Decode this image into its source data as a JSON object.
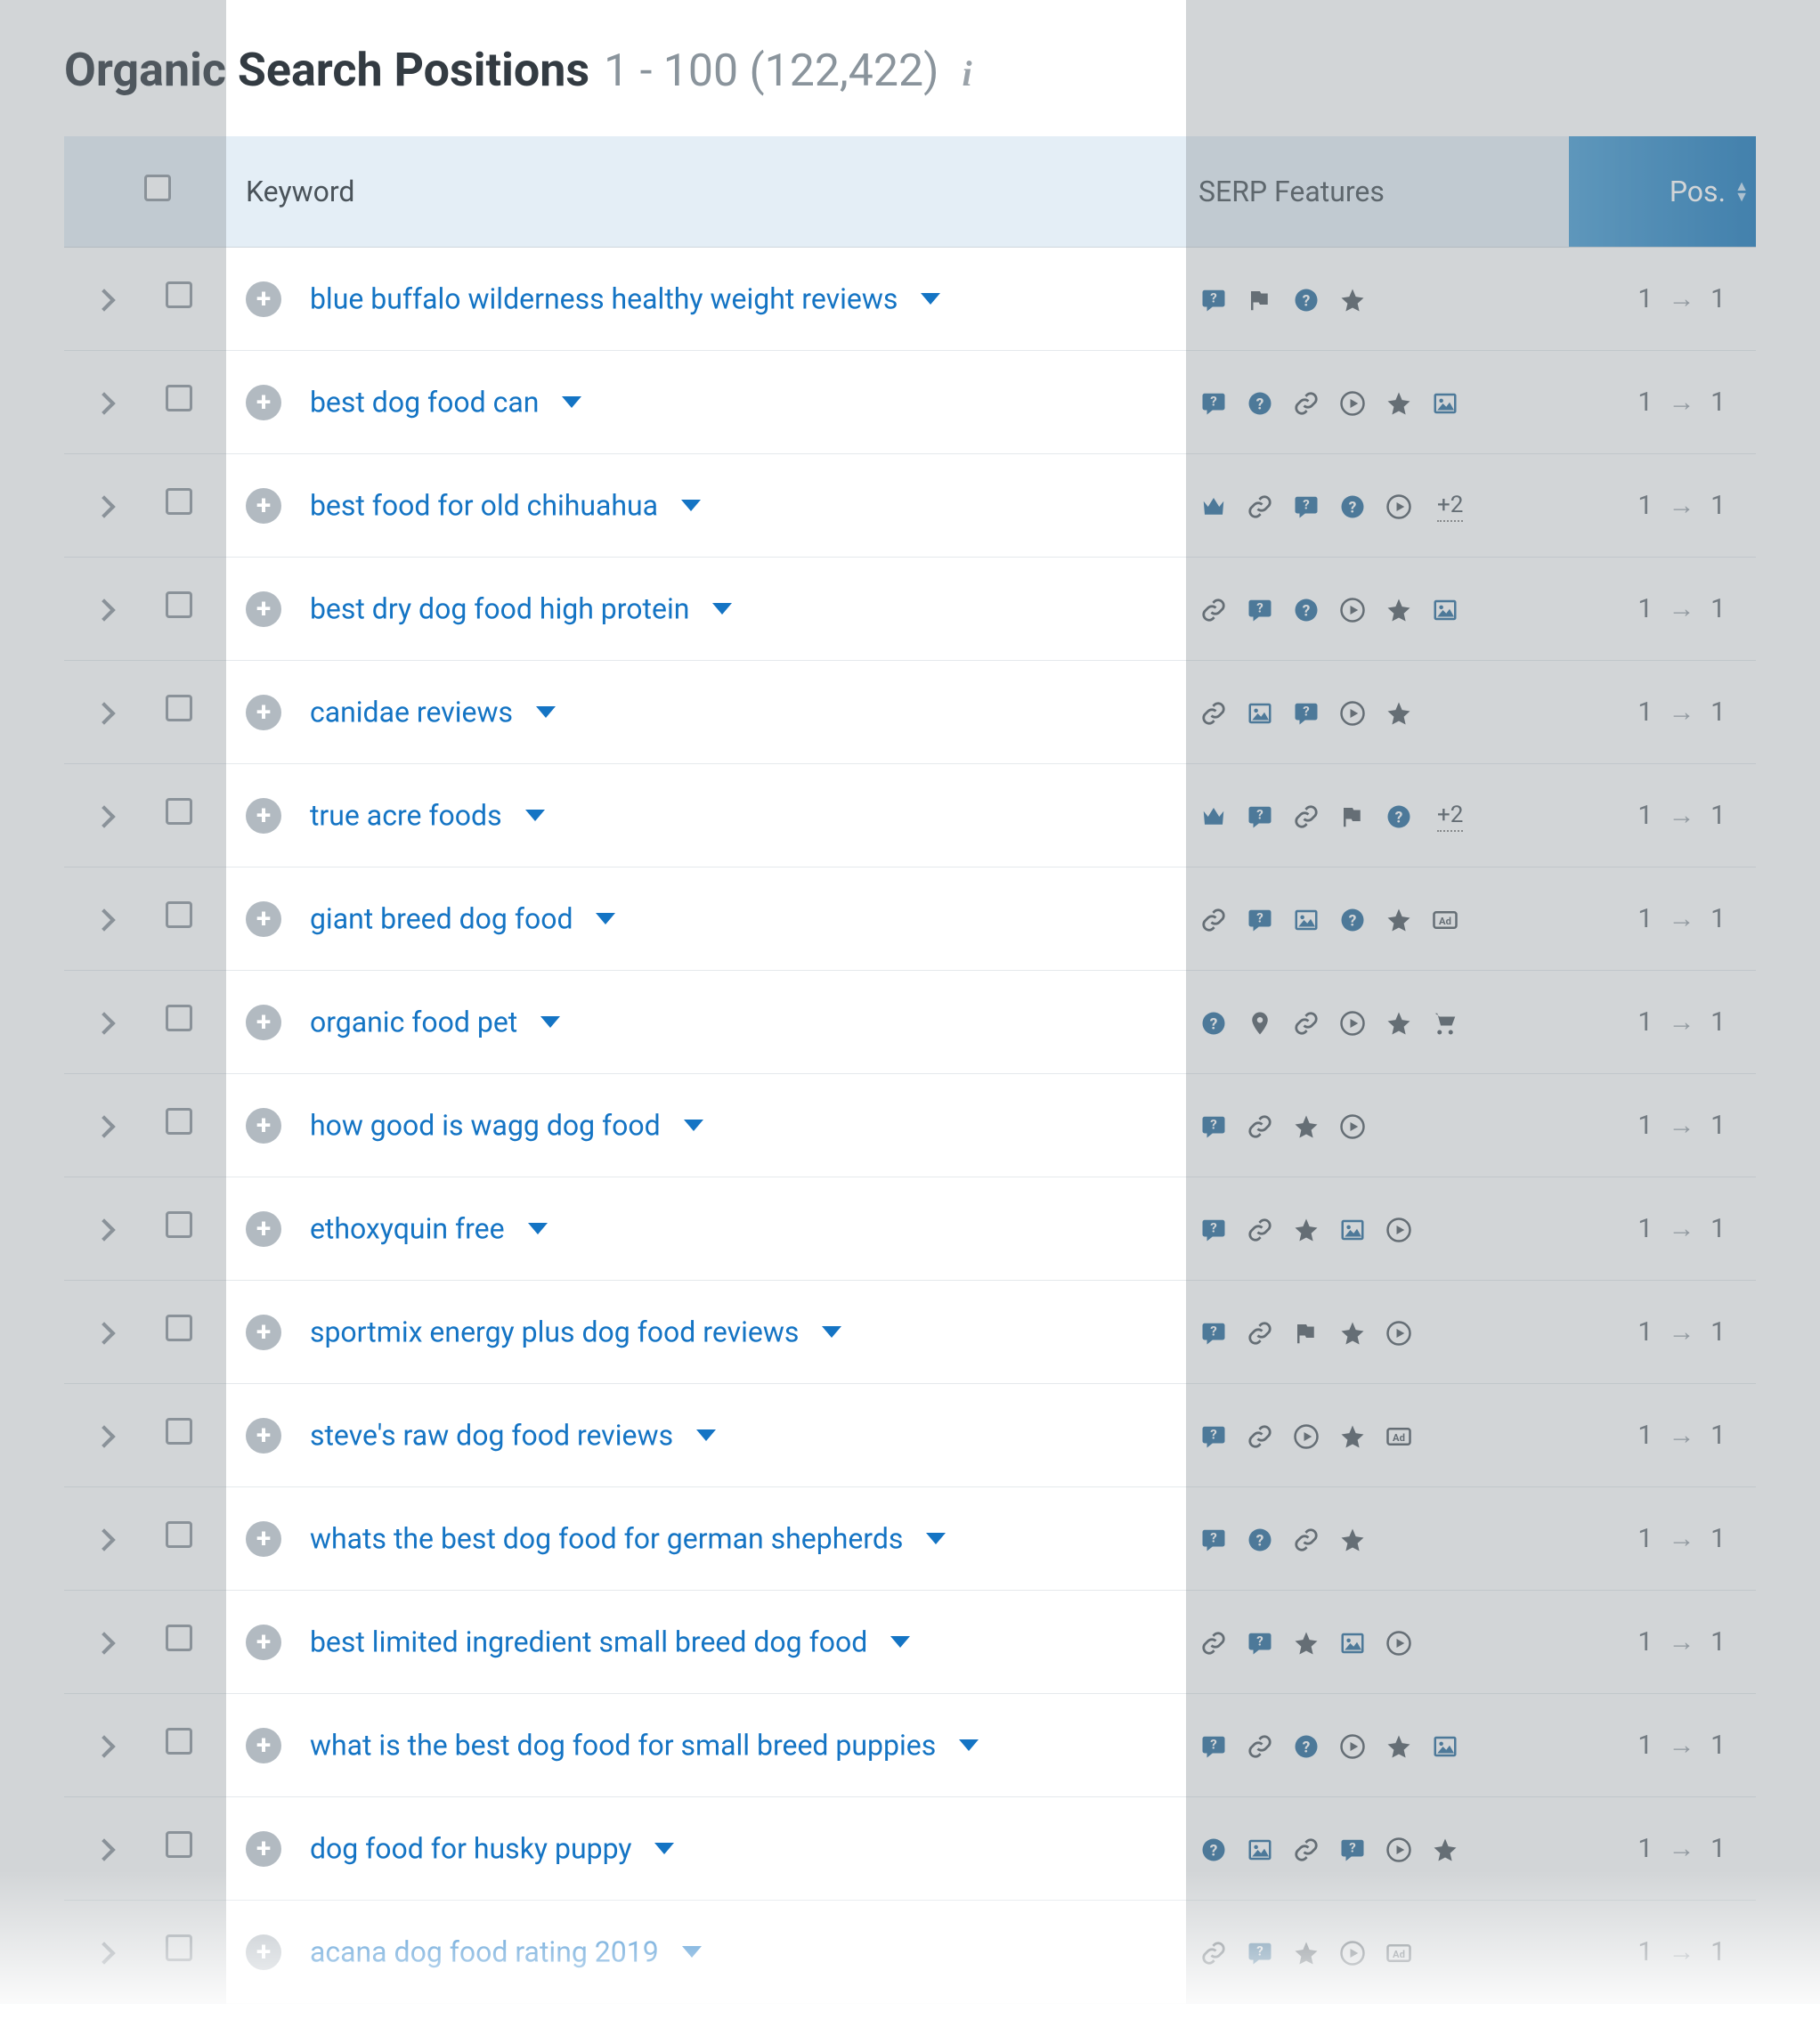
{
  "header": {
    "title": "Organic Search Positions",
    "range": "1 - 100 (122,422)"
  },
  "columns": {
    "keyword": "Keyword",
    "serp": "SERP Features",
    "pos": "Pos."
  },
  "icons": {
    "featured_snippet": "featured-snippet",
    "reviews": "reviews",
    "faq": "faq",
    "star": "star",
    "link": "link",
    "video": "video",
    "image": "image",
    "crown": "crown",
    "local": "local",
    "shopping": "shopping",
    "ads": "ads",
    "flag": "flag"
  },
  "rows": [
    {
      "kw": "blue buffalo wilderness healthy weight reviews",
      "serp": [
        "featured_snippet",
        "flag",
        "faq",
        "star"
      ],
      "plus": "",
      "pos1": "1",
      "pos2": "1"
    },
    {
      "kw": "best dog food can",
      "serp": [
        "featured_snippet",
        "faq",
        "link",
        "video",
        "star",
        "image"
      ],
      "plus": "",
      "pos1": "1",
      "pos2": "1"
    },
    {
      "kw": "best food for old chihuahua",
      "serp": [
        "crown",
        "link",
        "featured_snippet",
        "faq",
        "video"
      ],
      "plus": "+2",
      "pos1": "1",
      "pos2": "1"
    },
    {
      "kw": "best dry dog food high protein",
      "serp": [
        "link",
        "featured_snippet",
        "faq",
        "video",
        "star",
        "image"
      ],
      "plus": "",
      "pos1": "1",
      "pos2": "1"
    },
    {
      "kw": "canidae reviews",
      "serp": [
        "link",
        "image",
        "featured_snippet",
        "video",
        "star"
      ],
      "plus": "",
      "pos1": "1",
      "pos2": "1"
    },
    {
      "kw": "true acre foods",
      "serp": [
        "crown",
        "featured_snippet",
        "link",
        "flag",
        "faq"
      ],
      "plus": "+2",
      "pos1": "1",
      "pos2": "1"
    },
    {
      "kw": "giant breed dog food",
      "serp": [
        "link",
        "featured_snippet",
        "image",
        "faq",
        "star",
        "ads"
      ],
      "plus": "",
      "pos1": "1",
      "pos2": "1"
    },
    {
      "kw": "organic food pet",
      "serp": [
        "faq",
        "local",
        "link",
        "video",
        "star",
        "shopping"
      ],
      "plus": "",
      "pos1": "1",
      "pos2": "1"
    },
    {
      "kw": "how good is wagg dog food",
      "serp": [
        "featured_snippet",
        "link",
        "star",
        "video"
      ],
      "plus": "",
      "pos1": "1",
      "pos2": "1"
    },
    {
      "kw": "ethoxyquin free",
      "serp": [
        "featured_snippet",
        "link",
        "star",
        "image",
        "video"
      ],
      "plus": "",
      "pos1": "1",
      "pos2": "1"
    },
    {
      "kw": "sportmix energy plus dog food reviews",
      "serp": [
        "featured_snippet",
        "link",
        "flag",
        "star",
        "video"
      ],
      "plus": "",
      "pos1": "1",
      "pos2": "1"
    },
    {
      "kw": "steve's raw dog food reviews",
      "serp": [
        "featured_snippet",
        "link",
        "video",
        "star",
        "ads"
      ],
      "plus": "",
      "pos1": "1",
      "pos2": "1"
    },
    {
      "kw": "whats the best dog food for german shepherds",
      "serp": [
        "featured_snippet",
        "faq",
        "link",
        "star"
      ],
      "plus": "",
      "pos1": "1",
      "pos2": "1"
    },
    {
      "kw": "best limited ingredient small breed dog food",
      "serp": [
        "link",
        "featured_snippet",
        "star",
        "image",
        "video"
      ],
      "plus": "",
      "pos1": "1",
      "pos2": "1"
    },
    {
      "kw": "what is the best dog food for small breed puppies",
      "serp": [
        "featured_snippet",
        "link",
        "faq",
        "video",
        "star",
        "image"
      ],
      "plus": "",
      "pos1": "1",
      "pos2": "1"
    },
    {
      "kw": "dog food for husky puppy",
      "serp": [
        "faq",
        "image",
        "link",
        "featured_snippet",
        "video",
        "star"
      ],
      "plus": "",
      "pos1": "1",
      "pos2": "1"
    },
    {
      "kw": "acana dog food rating 2019",
      "serp": [
        "link",
        "featured_snippet",
        "star",
        "video",
        "ads"
      ],
      "plus": "",
      "pos1": "1",
      "pos2": "1"
    }
  ]
}
